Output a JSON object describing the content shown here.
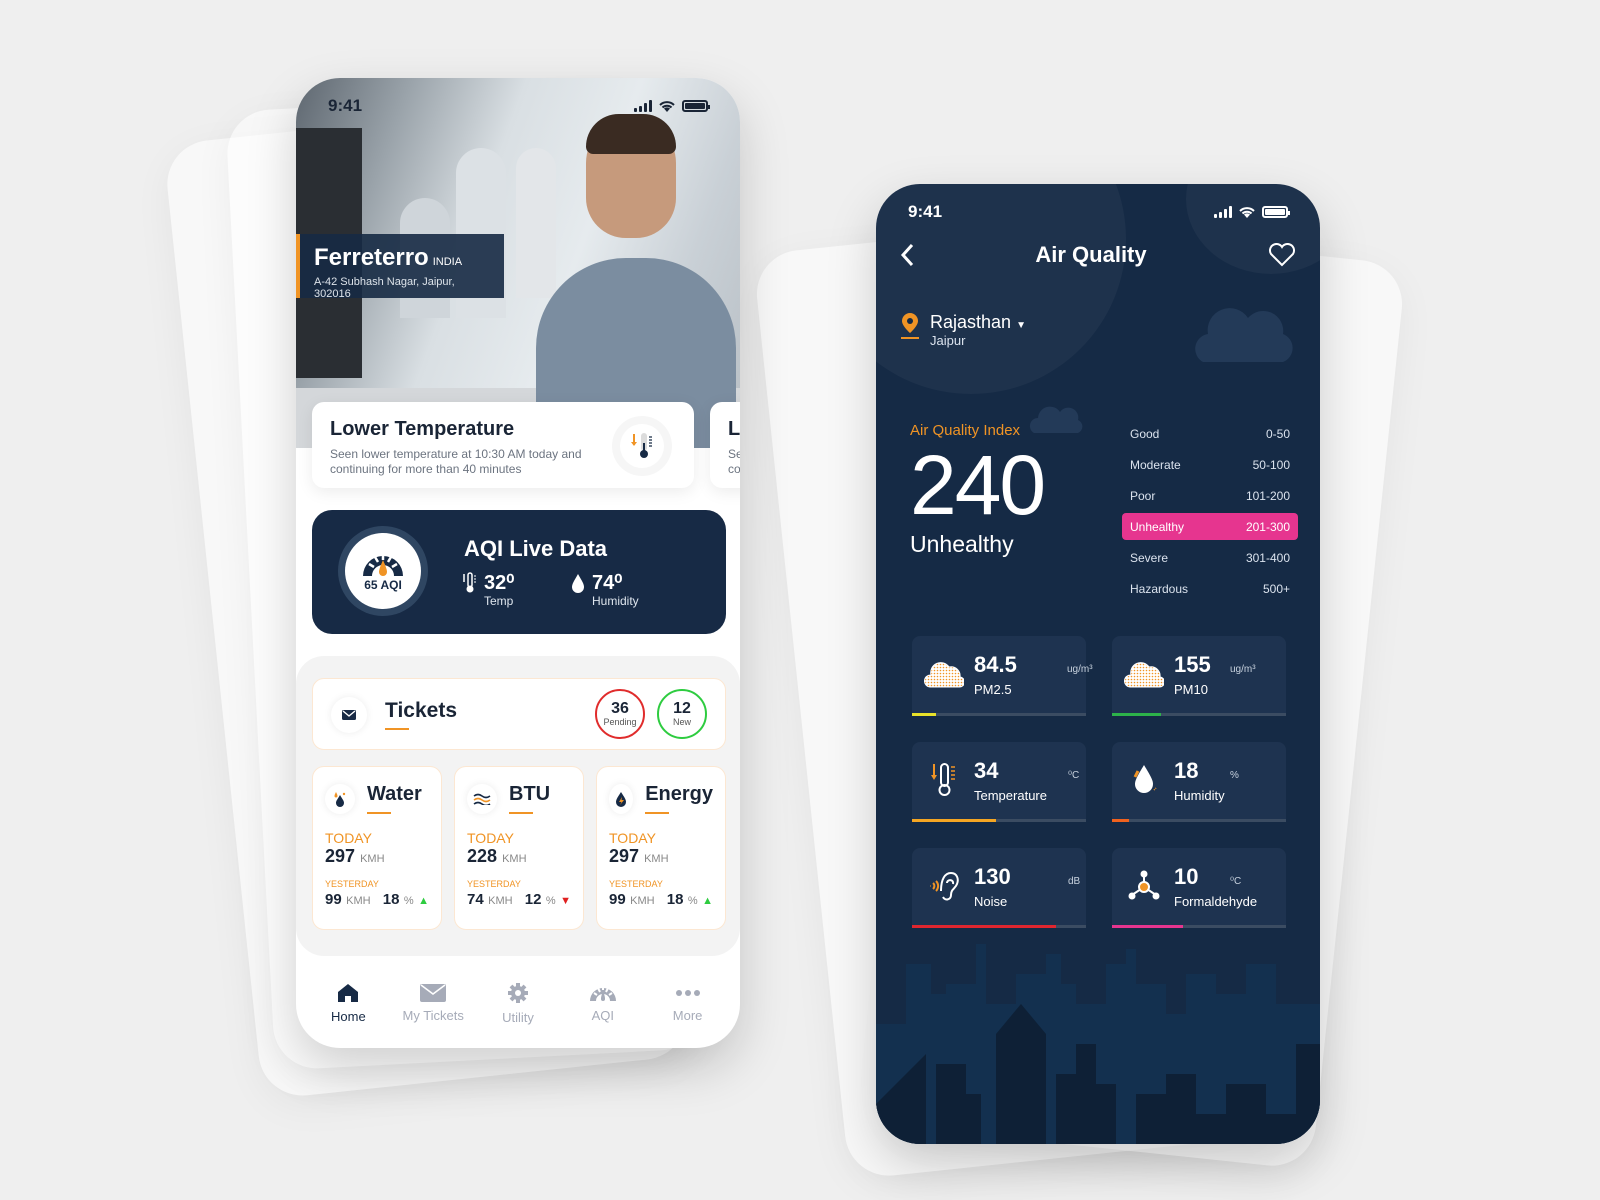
{
  "left_phone": {
    "status_time": "9:41",
    "company": {
      "name": "Ferreterro",
      "country": "INDIA",
      "address": "A-42 Subhash Nagar, Jaipur, 302016"
    },
    "alert": {
      "title": "Lower Temperature",
      "description": "Seen lower temperature at 10:30 AM today and continuing for more than 40 minutes",
      "icon": "thermometer-down-icon"
    },
    "alert_next": {
      "title": "L",
      "description": "Se co"
    },
    "aqi_live": {
      "title": "AQI Live Data",
      "aqi_label": "65 AQI",
      "temp_value": "32⁰",
      "temp_label": "Temp",
      "humidity_value": "74⁰",
      "humidity_label": "Humidity"
    },
    "tickets": {
      "title": "Tickets",
      "pending_count": "36",
      "pending_label": "Pending",
      "new_count": "12",
      "new_label": "New"
    },
    "utilities": [
      {
        "name": "Water",
        "icon": "water-drops-icon",
        "today_label": "TODAY",
        "today_value": "297",
        "today_unit": "KMH",
        "yesterday_label": "YESTERDAY",
        "yesterday_value": "99",
        "yesterday_unit": "KMH",
        "change": "18",
        "change_unit": "%",
        "trend": "▲"
      },
      {
        "name": "BTU",
        "icon": "waves-icon",
        "today_label": "TODAY",
        "today_value": "228",
        "today_unit": "KMH",
        "yesterday_label": "YESTERDAY",
        "yesterday_value": "74",
        "yesterday_unit": "KMH",
        "change": "12",
        "change_unit": "%",
        "trend": "▼"
      },
      {
        "name": "Energy",
        "icon": "energy-bolt-icon",
        "today_label": "TODAY",
        "today_value": "297",
        "today_unit": "KMH",
        "yesterday_label": "YESTERDAY",
        "yesterday_value": "99",
        "yesterday_unit": "KMH",
        "change": "18",
        "change_unit": "%",
        "trend": "▲"
      }
    ],
    "tabs": [
      {
        "label": "Home",
        "icon": "home-icon",
        "active": true
      },
      {
        "label": "My Tickets",
        "icon": "envelope-icon"
      },
      {
        "label": "Utility",
        "icon": "gear-icon"
      },
      {
        "label": "AQI",
        "icon": "gauge-icon"
      },
      {
        "label": "More",
        "icon": "more-dots-icon"
      }
    ]
  },
  "right_phone": {
    "status_time": "9:41",
    "title": "Air Quality",
    "location": {
      "state": "Rajasthan",
      "city": "Jaipur"
    },
    "aqi": {
      "label": "Air Quality Index",
      "value": "240",
      "category": "Unhealthy"
    },
    "scale": [
      {
        "name": "Good",
        "range": "0-50"
      },
      {
        "name": "Moderate",
        "range": "50-100"
      },
      {
        "name": "Poor",
        "range": "101-200"
      },
      {
        "name": "Unhealthy",
        "range": "201-300",
        "highlight": true
      },
      {
        "name": "Severe",
        "range": "301-400"
      },
      {
        "name": "Hazardous",
        "range": "500+"
      }
    ],
    "metrics": [
      {
        "name": "PM2.5",
        "value": "84.5",
        "unit": "ug/m³",
        "icon": "cloud-icon",
        "level": 0.14,
        "color": "#e8e22a"
      },
      {
        "name": "PM10",
        "value": "155",
        "unit": "ug/m³",
        "icon": "cloud-icon",
        "level": 0.28,
        "color": "#2db24a"
      },
      {
        "name": "Temperature",
        "value": "34",
        "unit": "⁰C",
        "icon": "thermometer-icon",
        "level": 0.48,
        "color": "#f5a623"
      },
      {
        "name": "Humidity",
        "value": "18",
        "unit": "%",
        "icon": "drop-icon",
        "level": 0.1,
        "color": "#f0621e"
      },
      {
        "name": "Noise",
        "value": "130",
        "unit": "dB",
        "icon": "ear-icon",
        "level": 0.83,
        "color": "#e0262f"
      },
      {
        "name": "Formaldehyde",
        "value": "10",
        "unit": "⁰C",
        "icon": "molecule-icon",
        "level": 0.41,
        "color": "#e6358f"
      }
    ]
  }
}
